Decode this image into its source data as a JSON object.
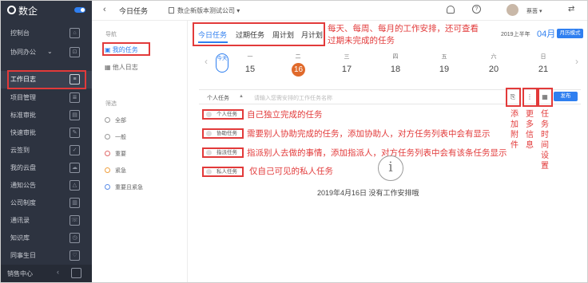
{
  "app": {
    "logo": "数企"
  },
  "sidebar": {
    "items": [
      {
        "label": "控制台",
        "icon": "home-icon"
      },
      {
        "label": "协同办公",
        "icon": "expand-icon"
      },
      {
        "label": "工作日志",
        "icon": "worklog-icon"
      },
      {
        "label": "项目管理",
        "icon": "project-icon"
      },
      {
        "label": "标准审批",
        "icon": "approval-icon"
      },
      {
        "label": "快速审批",
        "icon": "fast-approval-icon"
      },
      {
        "label": "云签到",
        "icon": "checkin-icon"
      },
      {
        "label": "我的云盘",
        "icon": "cloud-drive-icon"
      },
      {
        "label": "通知公告",
        "icon": "notice-icon"
      },
      {
        "label": "公司制度",
        "icon": "policy-icon"
      },
      {
        "label": "通讯录",
        "icon": "contacts-icon"
      },
      {
        "label": "知识库",
        "icon": "knowledge-icon"
      },
      {
        "label": "同事生日",
        "icon": "birthday-icon"
      }
    ],
    "bottom": "销售中心"
  },
  "topbar": {
    "back": "‹",
    "title": "今日任务",
    "company": "数企新版本测试公司",
    "user": "蔡茵"
  },
  "nav": {
    "heading": "导航",
    "mine": "我的任务",
    "other": "他人日志"
  },
  "filter": {
    "heading": "筛选",
    "items": [
      {
        "label": "全部",
        "color": "#999999"
      },
      {
        "label": "一般",
        "color": "#999999"
      },
      {
        "label": "重要",
        "color": "#e06a6a"
      },
      {
        "label": "紧急",
        "color": "#f0a040"
      },
      {
        "label": "重要且紧急",
        "color": "#5b8de8"
      }
    ]
  },
  "tabs": [
    "今日任务",
    "过期任务",
    "周计划",
    "月计划"
  ],
  "period": {
    "year": "2019上半年",
    "month": "04月",
    "mode": "月历模式"
  },
  "week": {
    "today": "今天",
    "days": [
      {
        "w": "一",
        "d": "15"
      },
      {
        "w": "二",
        "d": "16"
      },
      {
        "w": "三",
        "d": "17"
      },
      {
        "w": "四",
        "d": "18"
      },
      {
        "w": "五",
        "d": "19"
      },
      {
        "w": "六",
        "d": "20"
      },
      {
        "w": "日",
        "d": "21"
      }
    ]
  },
  "input": {
    "type": "个人任务",
    "placeholder": "请输入您需安排的工作任务名称",
    "publish": "发布"
  },
  "task_types": [
    "个人任务",
    "协助任务",
    "指派任务",
    "私人任务"
  ],
  "empty": {
    "text": "2019年4月16日 没有工作安排哦"
  },
  "annotations": {
    "tabs_note_1": "每天、每周、每月的工作安排，还可查看",
    "tabs_note_2": "过期未完成的任务",
    "personal": "自己独立完成的任务",
    "assist": "需要别人协助完成的任务，添加协助人，对方任务列表中会有显示",
    "assign": "指派别人去做的事情，添加指派人，对方任务列表中会有该条任务显示",
    "private": "仅自己可见的私人任务",
    "attach": "添加附件",
    "more": "更多信息",
    "time": "任务时间设置"
  }
}
